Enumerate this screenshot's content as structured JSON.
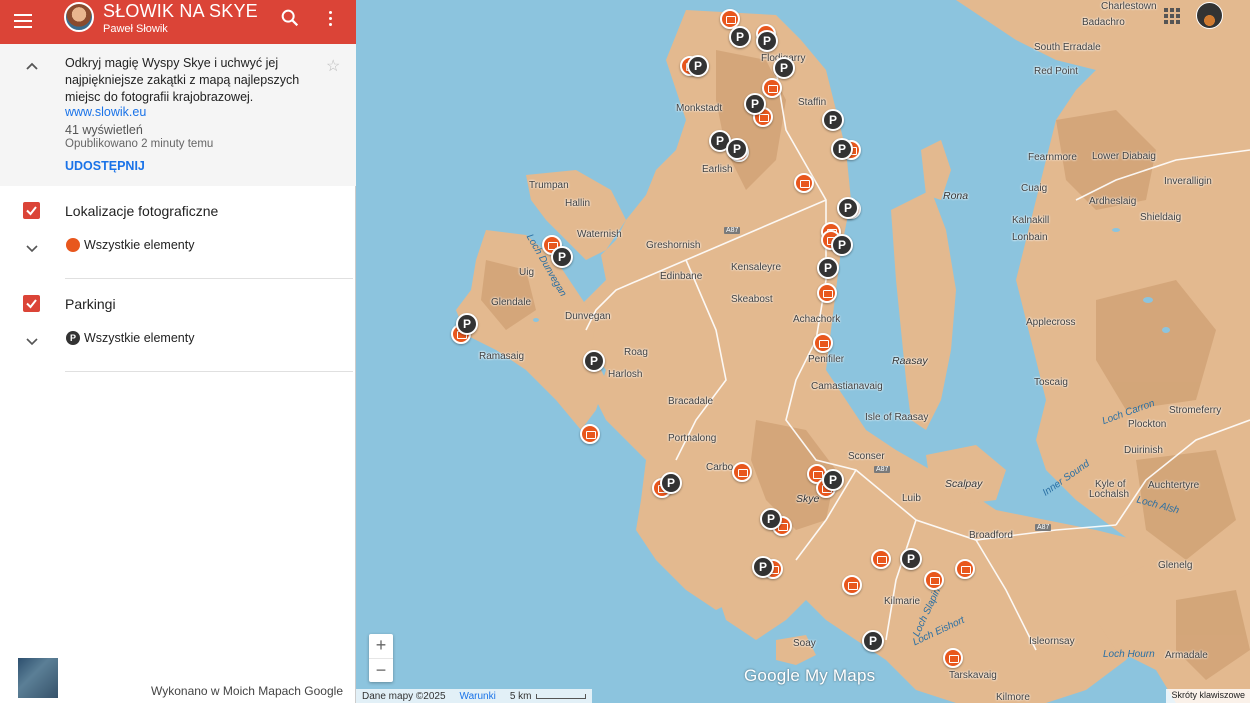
{
  "header": {
    "title": "SŁOWIK NA SKYE",
    "author": "Paweł Słowik"
  },
  "info": {
    "description": "Odkryj magię Wyspy Skye i uchwyć jej najpiękniejsze zakątki z mapą najlepszych miejsc do fotografii krajobrazowej.",
    "link": "www.slowik.eu",
    "views": "41 wyświetleń",
    "published": "Opublikowano 2 minuty temu",
    "share": "UDOSTĘPNIJ"
  },
  "layers": [
    {
      "name": "Lokalizacje fotograficzne",
      "item": "Wszystkie elementy",
      "color": "#e8571d",
      "icon": "camera-icon",
      "checked": true
    },
    {
      "name": "Parkingi",
      "item": "Wszystkie elementy",
      "color": "#333333",
      "icon": "parking-icon",
      "checked": true
    }
  ],
  "footer": {
    "credit": "Wykonano w Moich Mapach Google"
  },
  "map": {
    "logo": "Google My Maps",
    "data_label": "Dane mapy ©2025",
    "terms": "Warunki",
    "scale": "5 km",
    "shortcuts": "Skróty klawiszowe",
    "zoom_in": "+",
    "zoom_out": "−",
    "places": {
      "charlestown": "Charlestown",
      "badachro": "Badachro",
      "south_erradale": "South Erradale",
      "red_point": "Red Point",
      "staffin": "Staffin",
      "monkstadt": "Monkstadt",
      "earlish": "Earlish",
      "trumpan": "Trumpan",
      "hallin": "Hallin",
      "waternish": "Waternish",
      "greshornish": "Greshornish",
      "uig": "Uig",
      "edinbane": "Edinbane",
      "kensaleyre": "Kensaleyre",
      "skeabost": "Skeabost",
      "glendale": "Glendale",
      "dunvegan": "Dunvegan",
      "ramasaig": "Ramasaig",
      "roag": "Roag",
      "harlosh": "Harlosh",
      "achachork": "Achachork",
      "penifiler": "Penifiler",
      "camastianavaig": "Camastianavaig",
      "bracadale": "Bracadale",
      "portnalong": "Portnalong",
      "carbost": "Carbo",
      "sconser": "Sconser",
      "skye": "Skye",
      "luib": "Luib",
      "scalpay": "Scalpay",
      "broadford": "Broadford",
      "kilmarie": "Kilmarie",
      "soay": "Soay",
      "tarskavaig": "Tarskavaig",
      "kilmore": "Kilmore",
      "isleornsay": "Isleornsay",
      "armadale": "Armadale",
      "glenelg": "Glenelg",
      "kyle": "Kyle of",
      "kyle2": "Lochalsh",
      "auchtertyre": "Auchtertyre",
      "plockton": "Plockton",
      "duirinish": "Duirinish",
      "stromeferry": "Stromeferry",
      "toscaig": "Toscaig",
      "applecross": "Applecross",
      "lonbain": "Lonbain",
      "kalnakill": "Kalnakill",
      "ardheslaig": "Ardheslaig",
      "shieldaig": "Shieldaig",
      "inverallign": "Inveralligin",
      "cuaig": "Cuaig",
      "fearnmore": "Fearnmore",
      "lower_diabaig": "Lower Diabaig",
      "rona": "Rona",
      "raasay": "Raasay",
      "isle_of_raasay": "Isle of Raasay",
      "loch_dunvegan": "Loch Dunvegan",
      "loch_carron": "Loch Carron",
      "inner_sound": "Inner Sound",
      "loch_alsh": "Loch Alsh",
      "loch_hourn": "Loch Hourn",
      "loch_slapin": "Loch Slapin",
      "loch_eishort": "Loch Eishort",
      "flodigarry": "Flodigarry",
      "a87a": "A87",
      "a87b": "A87",
      "a87c": "A87"
    }
  }
}
